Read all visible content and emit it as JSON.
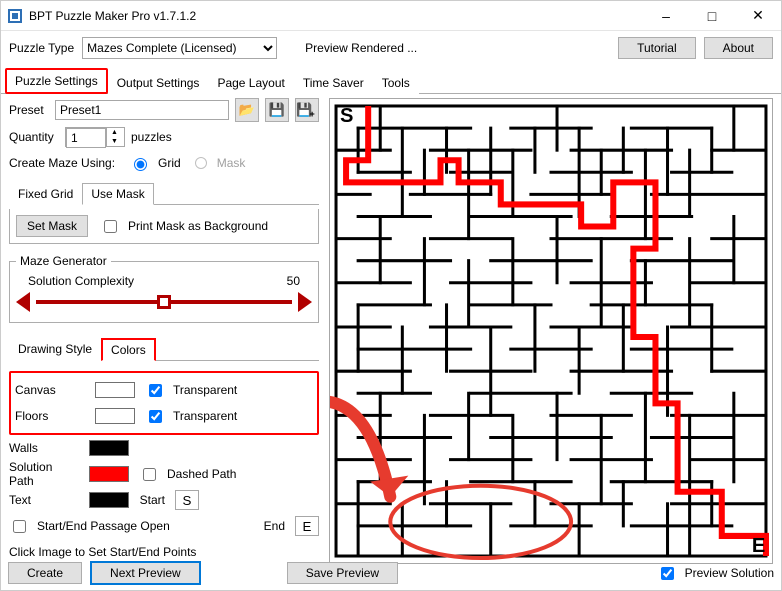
{
  "window": {
    "title": "BPT Puzzle Maker Pro v1.7.1.2"
  },
  "toprow": {
    "puzzle_type_label": "Puzzle Type",
    "puzzle_type_value": "Mazes Complete (Licensed)",
    "preview_text": "Preview Rendered ...",
    "tutorial": "Tutorial",
    "about": "About"
  },
  "tabs": {
    "puzzle_settings": "Puzzle Settings",
    "output_settings": "Output Settings",
    "page_layout": "Page Layout",
    "time_saver": "Time Saver",
    "tools": "Tools"
  },
  "preset": {
    "label": "Preset",
    "value": "Preset1"
  },
  "quantity": {
    "label": "Quantity",
    "value": "1",
    "unit": "puzzles"
  },
  "create_using": {
    "label": "Create Maze Using:",
    "grid": "Grid",
    "mask": "Mask"
  },
  "subtabs": {
    "fixed_grid": "Fixed Grid",
    "use_mask": "Use Mask"
  },
  "mask": {
    "set_mask": "Set Mask",
    "print_bg": "Print Mask as Background"
  },
  "generator": {
    "legend": "Maze Generator",
    "complexity_label": "Solution Complexity",
    "complexity_value": "50"
  },
  "style_tabs": {
    "drawing": "Drawing Style",
    "colors": "Colors"
  },
  "colors": {
    "canvas": "Canvas",
    "floors": "Floors",
    "walls": "Walls",
    "solution_path": "Solution Path",
    "text": "Text",
    "transparent": "Transparent",
    "dashed_path": "Dashed Path",
    "start_label": "Start",
    "start_value": "S",
    "end_label": "End",
    "end_value": "E",
    "passage_open": "Start/End Passage Open",
    "click_hint": "Click Image to Set Start/End Points",
    "swatches": {
      "canvas": "#ffffff",
      "floors": "#ffffff",
      "walls": "#000000",
      "solution": "#ff0000",
      "text": "#000000"
    }
  },
  "footer": {
    "create": "Create",
    "next_preview": "Next Preview",
    "save_preview": "Save Preview",
    "preview_solution": "Preview Solution"
  },
  "maze": {
    "start_marker": "S",
    "end_marker": "E"
  }
}
